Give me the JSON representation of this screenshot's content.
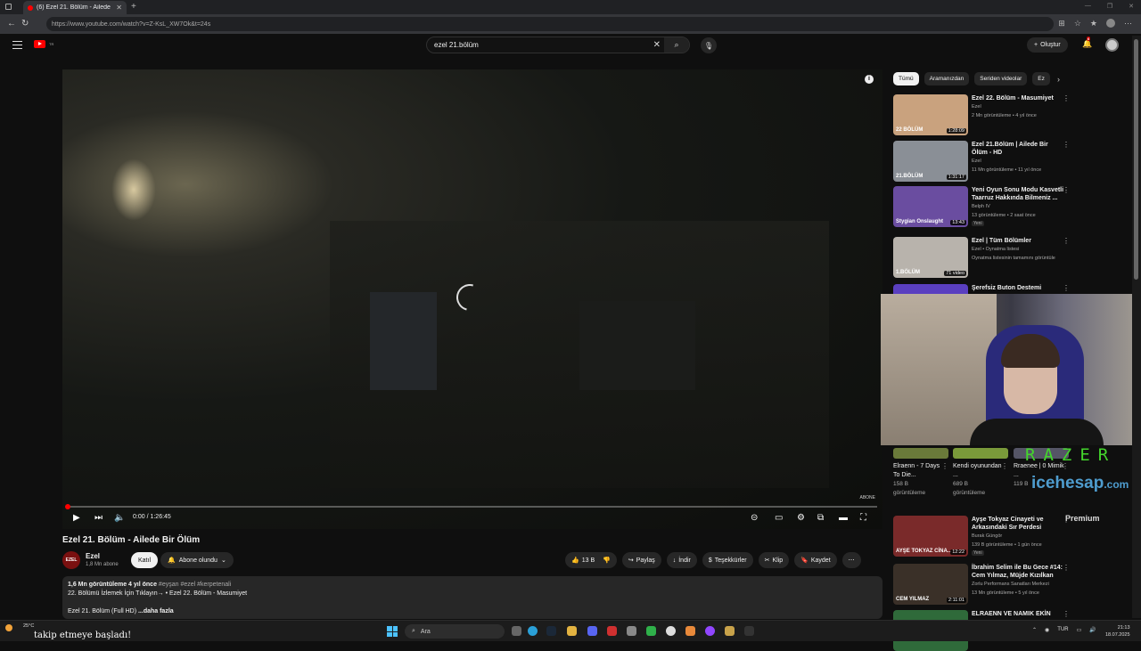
{
  "browser": {
    "tab_title": "(6) Ezel 21. Bölüm - Ailede Bir Öl...",
    "url": "https://www.youtube.com/watch?v=Z-KsL_XW7Ok&t=24s"
  },
  "header": {
    "brand": "Premium",
    "brand_sup": "TR",
    "search_value": "ezel 21.bölüm",
    "create_label": "Oluştur",
    "notification_count": "6"
  },
  "player": {
    "time": "0:00 / 1:26:45",
    "progress_fraction": 0.0,
    "watermark": "ABONE"
  },
  "video": {
    "title": "Ezel 21. Bölüm - Ailede Bir Ölüm",
    "channel": "Ezel",
    "channel_logo": "EZEL",
    "subscribers": "1,8 Mn abone",
    "join_label": "Katıl",
    "subscribed_label": "Abone olundu",
    "likes": "13 B",
    "share": "Paylaş",
    "download": "İndir",
    "thanks": "Teşekkürler",
    "clip": "Klip",
    "save": "Kaydet"
  },
  "description": {
    "stats": "1,6 Mn görüntüleme  4 yıl önce",
    "tags": "#eyşan #ezel #kerpetenali",
    "line2_text": "22. Bölümü İzlemek İçin Tıklayın→",
    "line2_link": "• Ezel 22. Bölüm - Masumiyet",
    "line3": "Ezel 21. Bölüm (Full HD)",
    "more": "...daha fazla"
  },
  "chips": [
    "Tümü",
    "Aramanızdan",
    "Seriden videolar",
    "Ez"
  ],
  "recommendations": [
    {
      "title": "Ezel 22. Bölüm - Masumiyet",
      "channel": "Ezel",
      "meta": "2 Mn görüntüleme • 4 yıl önce",
      "duration": "1:28:09",
      "color": "#c9a27e",
      "label": "22 BÖLÜM"
    },
    {
      "title": "Ezel 21.Bölüm | Ailede Bir Ölüm - HD",
      "channel": "Ezel",
      "meta": "11 Mn görüntüleme • 11 yıl önce",
      "duration": "1:31:17",
      "color": "#8a8f96",
      "label": "21.BÖLÜM"
    },
    {
      "title": "Yeni Oyun Sonu Modu Kasvetli Taarruz Hakkında Bilmeniz ...",
      "channel": "Belph IV",
      "meta": "13 görüntüleme • 2 saat önce",
      "duration": "13:43",
      "color": "#6a4da0",
      "label": "Stygian Onslaught",
      "badge": "Yeni"
    },
    {
      "title": "Ezel | Tüm Bölümler",
      "channel": "Ezel • Oynatma listesi",
      "meta": "Oynatma listesinin tamamını görüntüle",
      "duration": "71 video",
      "color": "#b8b3ac",
      "label": "1.BÖLÜM"
    },
    {
      "title": "Şerefsiz Buton Destemi",
      "channel": "",
      "meta": "",
      "duration": "",
      "color": "#5a3fc0",
      "label": ""
    }
  ],
  "shorts": [
    {
      "title": "Elraenn - 7 Days To Die...",
      "views": "158 B",
      "unit": "görüntüleme"
    },
    {
      "title": "Kendi oyunundan ...",
      "views": "689 B",
      "unit": "görüntüleme"
    },
    {
      "title": "Rraenee | 0 Mimik ...",
      "views": "119 B",
      "unit": ""
    }
  ],
  "recommendations2": [
    {
      "title": "Ayşe Tokyaz Cinayeti ve Arkasındaki Sır Perdesi",
      "channel": "Burak Güngör",
      "meta": "139 B görüntüleme • 1 gün önce",
      "duration": "12:22",
      "color": "#7a2a2a",
      "label": "AYŞE TOKYAZ CİNA...",
      "badge": "Yeni"
    },
    {
      "title": "İbrahim Selim ile Bu Gece #14: Cem Yılmaz, Müjde Kızılkan",
      "channel": "Zorlu Performans Sanatları Merkezi",
      "meta": "13 Mn görüntüleme • 5 yıl önce",
      "duration": "2:11:01",
      "color": "#3a3028",
      "label": "CEM YILMAZ"
    },
    {
      "title": "ELRAENN VE NAMIK EKİN",
      "channel": "",
      "meta": "",
      "duration": "",
      "color": "#2f6a3a",
      "label": ""
    }
  ],
  "overlay": {
    "brand": "RAZER",
    "watermark": "icehesap",
    "watermark_tld": ".com"
  },
  "taskbar": {
    "temp": "25°C",
    "notification": "takip etmeye başladı!",
    "search_placeholder": "Ara",
    "lang": "TUR",
    "time": "21:13",
    "date": "18.07.2025"
  },
  "colors": {
    "accent": "#ff0000",
    "link": "#3ea6ff",
    "razer": "#44d62c"
  }
}
